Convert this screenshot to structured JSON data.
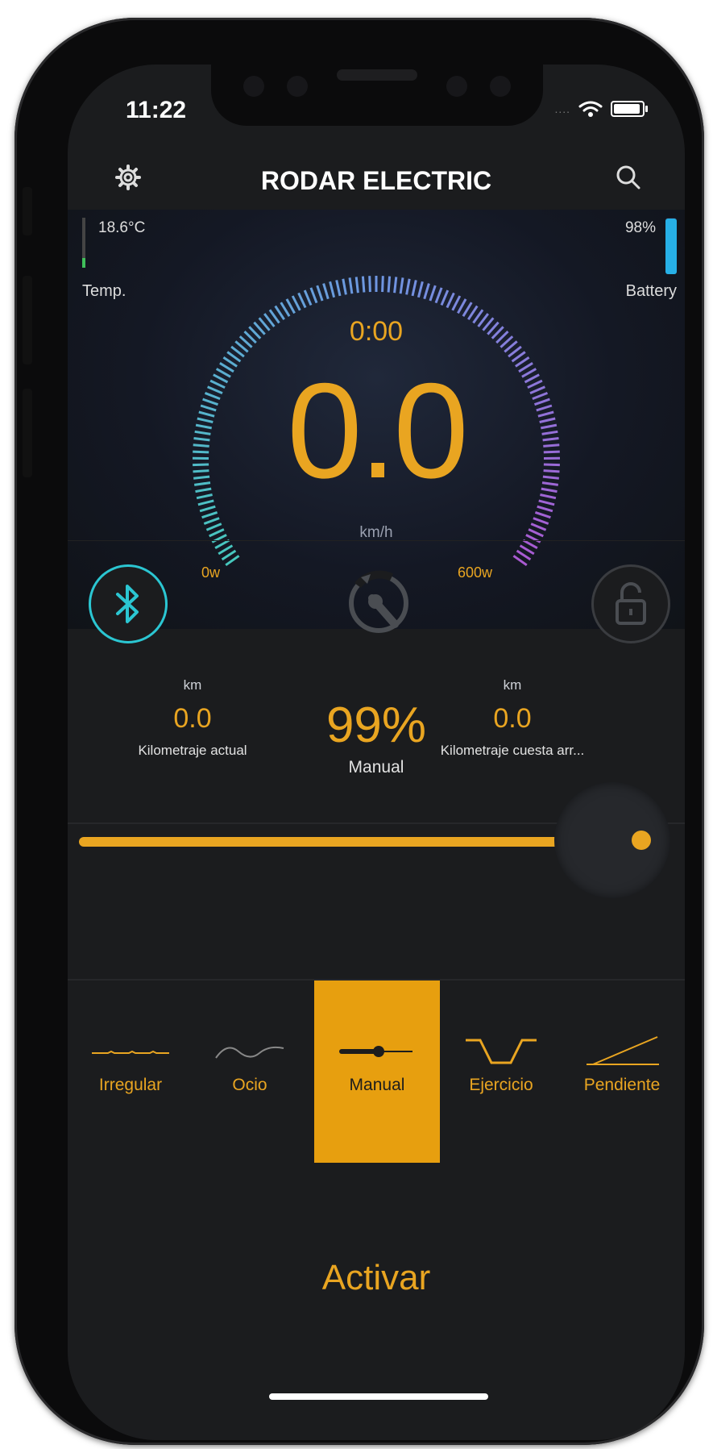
{
  "status_bar": {
    "time": "11:22"
  },
  "header": {
    "title": "RODAR ELECTRIC"
  },
  "dashboard": {
    "temperature": {
      "value": "18.6°C",
      "label": "Temp.",
      "level": 0.2
    },
    "battery": {
      "value": "98%",
      "label": "Battery",
      "level": 0.98
    },
    "timer": "0:00",
    "speed": "0.0",
    "speed_unit": "km/h",
    "power_min": "0w",
    "power_max": "600w"
  },
  "stats": {
    "current_distance": {
      "unit": "km",
      "value": "0.0",
      "label": "Kilometraje actual"
    },
    "assist": {
      "value": "99%",
      "label": "Manual"
    },
    "uphill_distance": {
      "unit": "km",
      "value": "0.0",
      "label": "Kilometraje cuesta arr..."
    }
  },
  "slider": {
    "level": 0.99
  },
  "modes": [
    {
      "label": "Irregular",
      "icon": "irregular-road-icon",
      "active": false
    },
    {
      "label": "Ocio",
      "icon": "wave-icon",
      "active": false
    },
    {
      "label": "Manual",
      "icon": "manual-slider-icon",
      "active": true
    },
    {
      "label": "Ejercicio",
      "icon": "valley-icon",
      "active": false
    },
    {
      "label": "Pendiente",
      "icon": "slope-icon",
      "active": false
    }
  ],
  "activate_label": "Activar",
  "colors": {
    "accent": "#e9a521",
    "bluetooth": "#2bc6d2",
    "battery": "#27b0e6",
    "background": "#1b1c1e"
  }
}
